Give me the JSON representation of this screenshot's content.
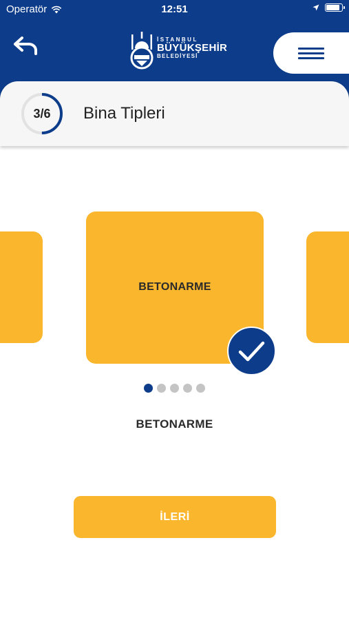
{
  "status_bar": {
    "carrier": "Operatör",
    "time": "12:51",
    "battery_level": 0.95,
    "icons": [
      "wifi-icon",
      "location-arrow-icon",
      "battery-icon"
    ]
  },
  "header": {
    "back_icon": "undo-arrow-icon",
    "logo": {
      "line1": "İSTANBUL",
      "line2": "BÜYÜKŞEHİR",
      "line3": "BELEDİYESİ"
    },
    "menu_icon": "hamburger-menu-icon"
  },
  "step": {
    "current": 3,
    "total": 6,
    "label": "3/6",
    "title": "Bina Tipleri"
  },
  "carousel": {
    "selected_label": "BETONARME",
    "dot_count": 5,
    "active_index": 0
  },
  "selection": {
    "name": "BETONARME"
  },
  "actions": {
    "next_label": "İLERİ"
  },
  "colors": {
    "primary": "#0c3c8a",
    "accent": "#fab62d",
    "card_bg": "#f6f6f6"
  }
}
